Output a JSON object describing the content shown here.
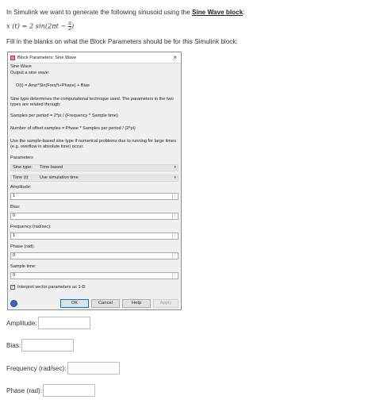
{
  "intro": {
    "text": "In Simulink we want to generate the following sinusoid using the ",
    "link": "Sine Wave block",
    "after": ":"
  },
  "equation": {
    "lhs": "x (t) = 2 sin(2πt −",
    "num": "π",
    "den": "2",
    "rhs": ")"
  },
  "instruction": "Fill in the blanks on what the Block Parameters should be for this Simulink block:",
  "dialog": {
    "title": "Block Parameters: Sine Wave",
    "block_name": "Sine Wave",
    "subtitle": "Output a sine wave:",
    "formula": "O(t) = Amp*Sin(Freq*t+Phase) + Bias",
    "desc1": "Sine type determines the computational technique used. The parameters in the two types are related through:",
    "desc2": "Samples per period = 2*pi / (Frequency * Sample time)",
    "desc3": "Number of offset samples = Phase * Samples per period / (2*pi)",
    "desc4": "Use the sample-based sine type if numerical problems due to running for large times (e.g. overflow in absolute time) occur.",
    "parameters_header": "Parameters",
    "sine_type": {
      "label": "Sine type:",
      "value": "Time based"
    },
    "time": {
      "label": "Time (t):",
      "value": "Use simulation time"
    },
    "fields": [
      {
        "label": "Amplitude:",
        "value": "1"
      },
      {
        "label": "Bias:",
        "value": "0"
      },
      {
        "label": "Frequency (rad/sec):",
        "value": "1"
      },
      {
        "label": "Phase (rad):",
        "value": "0"
      },
      {
        "label": "Sample time:",
        "value": "0"
      }
    ],
    "checkbox_label": "Interpret vector parameters as 1-D",
    "buttons": {
      "ok": "OK",
      "cancel": "Cancel",
      "help": "Help",
      "apply": "Apply"
    },
    "close_glyph": "×",
    "dots_glyph": "⋮",
    "arrow_glyph": "▾",
    "check_glyph": "✓"
  },
  "answers": [
    {
      "label": "Amplitude:"
    },
    {
      "label": "Bias:"
    },
    {
      "label": "Frequency (rad/sec):"
    },
    {
      "label": "Phase (rad):"
    }
  ]
}
